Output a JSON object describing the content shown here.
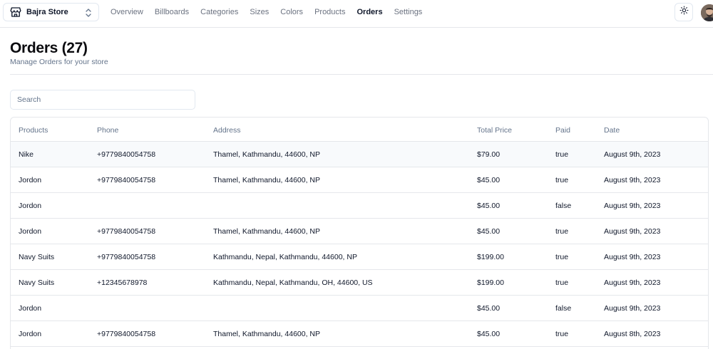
{
  "store": {
    "name": "Bajra Store"
  },
  "nav": {
    "items": [
      "Overview",
      "Billboards",
      "Categories",
      "Sizes",
      "Colors",
      "Products",
      "Orders",
      "Settings"
    ],
    "active": "Orders"
  },
  "page": {
    "title": "Orders (27)",
    "subtitle": "Manage Orders for your store"
  },
  "search": {
    "placeholder": "Search",
    "value": ""
  },
  "table": {
    "columns": [
      "Products",
      "Phone",
      "Address",
      "Total Price",
      "Paid",
      "Date"
    ],
    "rows": [
      [
        "Nike",
        "+9779840054758",
        "Thamel, Kathmandu, 44600, NP",
        "$79.00",
        "true",
        "August 9th, 2023"
      ],
      [
        "Jordon",
        "+9779840054758",
        "Thamel, Kathmandu, 44600, NP",
        "$45.00",
        "true",
        "August 9th, 2023"
      ],
      [
        "Jordon",
        "",
        "",
        "$45.00",
        "false",
        "August 9th, 2023"
      ],
      [
        "Jordon",
        "+9779840054758",
        "Thamel, Kathmandu, 44600, NP",
        "$45.00",
        "true",
        "August 9th, 2023"
      ],
      [
        "Navy Suits",
        "+9779840054758",
        "Kathmandu, Nepal, Kathmandu, 44600, NP",
        "$199.00",
        "true",
        "August 9th, 2023"
      ],
      [
        "Navy Suits",
        "+12345678978",
        "Kathmandu, Nepal, Kathmandu, OH, 44600, US",
        "$199.00",
        "true",
        "August 9th, 2023"
      ],
      [
        "Jordon",
        "",
        "",
        "$45.00",
        "false",
        "August 9th, 2023"
      ],
      [
        "Jordon",
        "+9779840054758",
        "Thamel, Kathmandu, 44600, NP",
        "$45.00",
        "true",
        "August 8th, 2023"
      ]
    ],
    "highlighted_row": 0
  },
  "icons": {
    "store": "store-icon",
    "switcher": "chevrons-up-down-icon",
    "theme": "sun-icon"
  },
  "colors": {
    "text": "#0f172a",
    "muted": "#64748b",
    "border": "#e5e7eb",
    "row_hover": "#f8fafc"
  }
}
